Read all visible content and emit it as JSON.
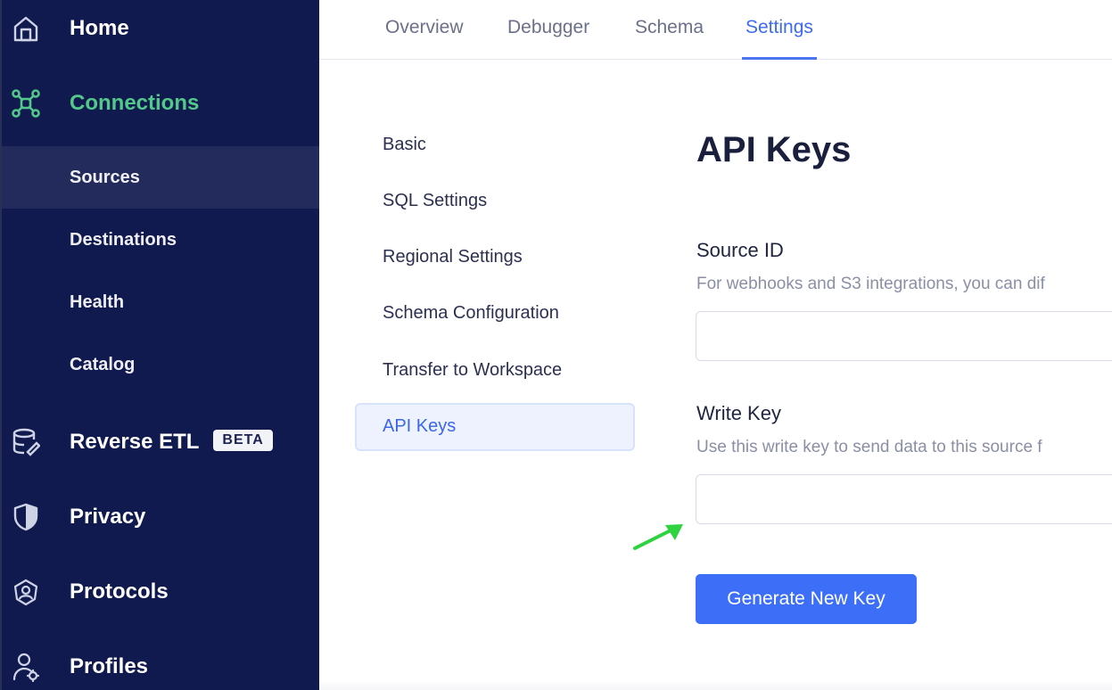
{
  "sidebar": {
    "items": [
      {
        "label": "Home",
        "icon": "home-icon"
      },
      {
        "label": "Connections",
        "icon": "connections-icon",
        "active": true
      },
      {
        "label": "Reverse ETL",
        "icon": "database-icon",
        "badge": "BETA"
      },
      {
        "label": "Privacy",
        "icon": "shield-icon"
      },
      {
        "label": "Protocols",
        "icon": "protocols-icon"
      },
      {
        "label": "Profiles",
        "icon": "profiles-icon"
      }
    ],
    "sub_items": [
      {
        "label": "Sources",
        "selected": true
      },
      {
        "label": "Destinations"
      },
      {
        "label": "Health"
      },
      {
        "label": "Catalog"
      }
    ],
    "active_color": "#52c98a",
    "background": "#111a4f"
  },
  "tabs": [
    {
      "label": "Overview"
    },
    {
      "label": "Debugger"
    },
    {
      "label": "Schema"
    },
    {
      "label": "Settings",
      "active": true
    }
  ],
  "settings_menu": [
    {
      "label": "Basic"
    },
    {
      "label": "SQL Settings"
    },
    {
      "label": "Regional Settings"
    },
    {
      "label": "Schema Configuration"
    },
    {
      "label": "Transfer to Workspace"
    },
    {
      "label": "API Keys",
      "active": true
    }
  ],
  "content": {
    "title": "API Keys",
    "source_id": {
      "label": "Source ID",
      "help": "For webhooks and S3 integrations, you can dif",
      "value": ""
    },
    "write_key": {
      "label": "Write Key",
      "help": "Use this write key to send data to this source f",
      "value": ""
    },
    "generate_button": "Generate New Key"
  },
  "colors": {
    "accent": "#3d6ef7",
    "annotation_arrow": "#2fd23f"
  }
}
